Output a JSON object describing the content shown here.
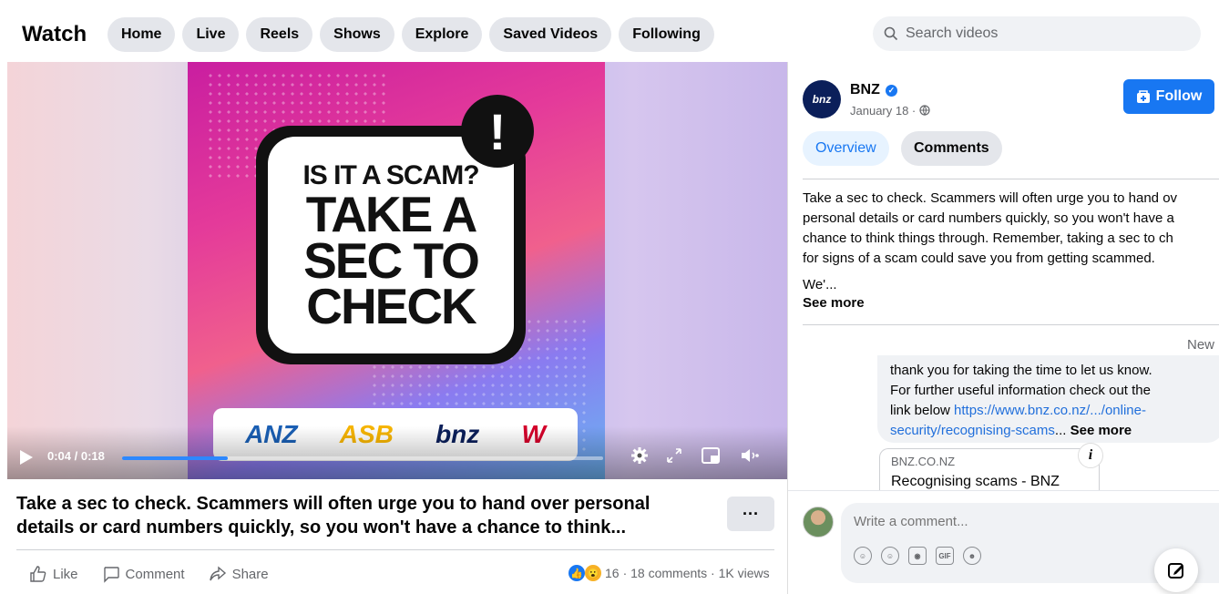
{
  "header": {
    "title": "Watch",
    "tabs": [
      "Home",
      "Live",
      "Reels",
      "Shows",
      "Explore",
      "Saved Videos",
      "Following"
    ],
    "search_placeholder": "Search videos"
  },
  "video": {
    "headline_line1": "IS IT A SCAM?",
    "headline_big": [
      "TAKE A",
      "SEC TO",
      "CHECK"
    ],
    "alert_symbol": "!",
    "banks": [
      "ANZ",
      "ASB",
      "bnz",
      "W"
    ],
    "time": "0:04 / 0:18",
    "progress": 0.22
  },
  "post": {
    "title": "Take a sec to check. Scammers will often urge you to hand over personal details or card numbers quickly, so you won't have a chance to think...",
    "more_label": "···",
    "actions": {
      "like": "Like",
      "comment": "Comment",
      "share": "Share"
    },
    "reaction_count": "16",
    "stats_text": "· 18 comments · 1K views"
  },
  "sidebar": {
    "page_name": "BNZ",
    "avatar_text": "bnz",
    "date": "January 18 ·",
    "follow_label": "Follow",
    "segments": {
      "overview": "Overview",
      "comments": "Comments"
    },
    "description": [
      "Take a sec to check. Scammers will often urge you to hand ov",
      "personal details or card numbers quickly, so you won't have a",
      "chance to think things through. Remember, taking a sec to ch",
      "for signs of a scam could save you from getting scammed."
    ],
    "desc_cut": "We'...",
    "see_more": "See more",
    "sort_label": "New",
    "reply": {
      "line1": "thank you for taking the time to let us know.",
      "line2": "For further useful information check out the",
      "line3_prefix": "link below ",
      "link_text": "https://www.bnz.co.nz/.../online-",
      "link_text2": "security/recognising-scams",
      "ellipsis": "...",
      "see_more": "See more"
    },
    "link_card": {
      "domain": "BNZ.CO.NZ",
      "title": "Recognising scams - BNZ"
    },
    "composer_placeholder": "Write a comment...",
    "composer_tools": [
      "sticker-icon",
      "emoji-icon",
      "camera-icon",
      "gif-icon",
      "avatar-sticker-icon"
    ]
  },
  "colors": {
    "accent": "#1877f2",
    "link": "#216fdb",
    "bnz_navy": "#0b1f5a"
  }
}
